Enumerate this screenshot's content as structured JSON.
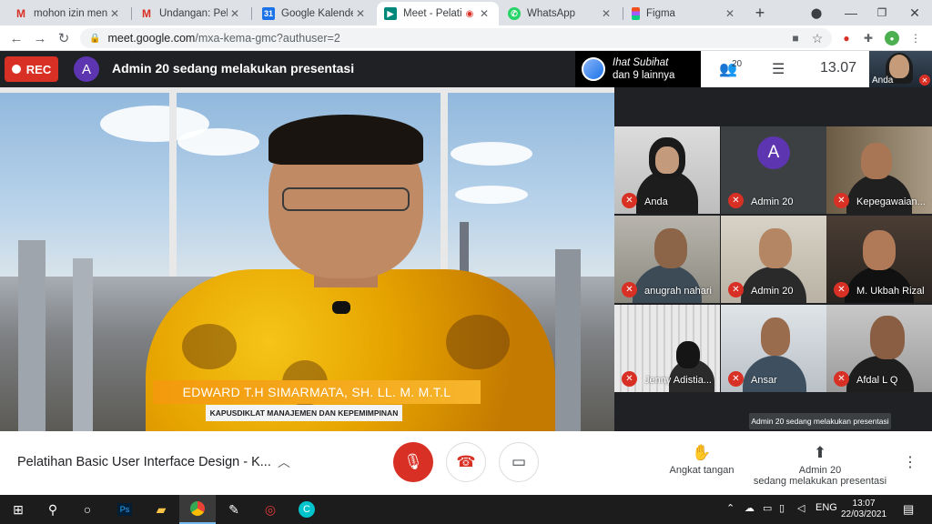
{
  "browser": {
    "tabs": [
      {
        "title": "mohon izin menginf",
        "favicon": "gmail-icon",
        "active": false
      },
      {
        "title": "Undangan: Pelatiha",
        "favicon": "gmail-icon",
        "active": false
      },
      {
        "title": "Google Kalender - I",
        "favicon": "calendar-icon",
        "active": false
      },
      {
        "title": "Meet - Pelatihan",
        "favicon": "meet-icon",
        "active": true
      },
      {
        "title": "WhatsApp",
        "favicon": "whatsapp-icon",
        "active": false
      },
      {
        "title": "Figma",
        "favicon": "figma-icon",
        "active": false
      }
    ],
    "new_tab": "+",
    "url_host": "meet.google.com",
    "url_path": "/mxa-kema-gmc?authuser=2"
  },
  "meet": {
    "rec_label": "REC",
    "presenter_initial": "A",
    "presenting_text": "Admin 20 sedang melakukan presentasi",
    "people_chip_first": "Ihat Subihat",
    "people_chip_rest": "dan 9 lainnya",
    "people_count": "20",
    "clock": "13.07",
    "self_label": "Anda",
    "main_video": {
      "lower_third_name": "EDWARD T.H SIMARMATA, SH. LL. M. M.T.L",
      "lower_third_title": "KAPUSDIKLAT MANAJEMEN DAN KEPEMIMPINAN"
    },
    "participants": [
      {
        "name": "Anda",
        "type": "video"
      },
      {
        "name": "Admin 20",
        "type": "avatar",
        "initial": "A"
      },
      {
        "name": "Kepegawaian...",
        "type": "video"
      },
      {
        "name": "anugrah nahari",
        "type": "video"
      },
      {
        "name": "Admin 20",
        "type": "video"
      },
      {
        "name": "M. Ukbah Rizal",
        "type": "video"
      },
      {
        "name": "Jenny Adistia...",
        "type": "video"
      },
      {
        "name": "Ansar",
        "type": "video"
      },
      {
        "name": "Afdal L Q",
        "type": "video"
      }
    ],
    "tooltip": "Admin 20 sedang melakukan presentasi",
    "meeting_title": "Pelatihan Basic User Interface Design - K...",
    "raise_hand_label": "Angkat tangan",
    "present_label_line1": "Admin 20",
    "present_label_line2": "sedang melakukan presentasi"
  },
  "taskbar": {
    "lang": "ENG",
    "time": "13:07",
    "date": "22/03/2021"
  }
}
